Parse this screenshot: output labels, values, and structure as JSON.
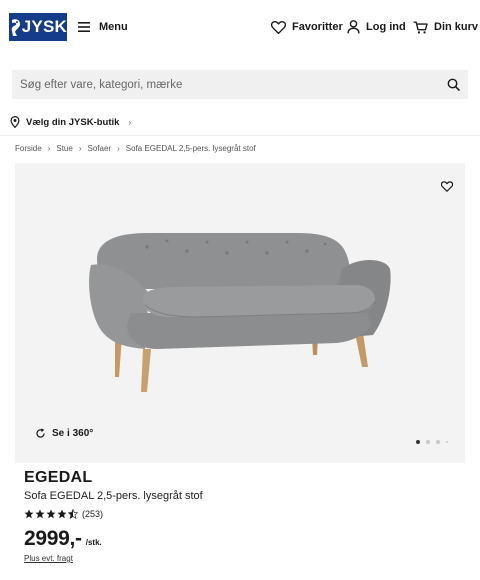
{
  "header": {
    "logo_text": "JYSK",
    "menu_label": "Menu",
    "favorites_label": "Favoritter",
    "login_label": "Log ind",
    "cart_label": "Din kurv"
  },
  "search": {
    "placeholder": "Søg efter vare, kategori, mærke"
  },
  "store": {
    "label": "Vælg din JYSK-butik",
    "chevron": "›"
  },
  "breadcrumb": {
    "items": [
      "Forside",
      "Stue",
      "Sofaer",
      "Sofa EGEDAL 2,5-pers. lysegråt stof"
    ],
    "separator": "›"
  },
  "gallery": {
    "rotate_label": "Se i 360°",
    "image_count": 4,
    "active_index": 0,
    "sofa_color": "#8f9091"
  },
  "product": {
    "name": "EGEDAL",
    "description": "Sofa EGEDAL 2,5-pers. lysegråt stof",
    "rating": 4.5,
    "review_count": "(253)",
    "price": "2999,-",
    "price_unit": "/stk.",
    "shipping_note": "Plus evt. fragt"
  },
  "colors": {
    "brand": "#143c8a",
    "search_bg": "#f0f0f0",
    "gallery_bg": "#f3f3f3"
  }
}
